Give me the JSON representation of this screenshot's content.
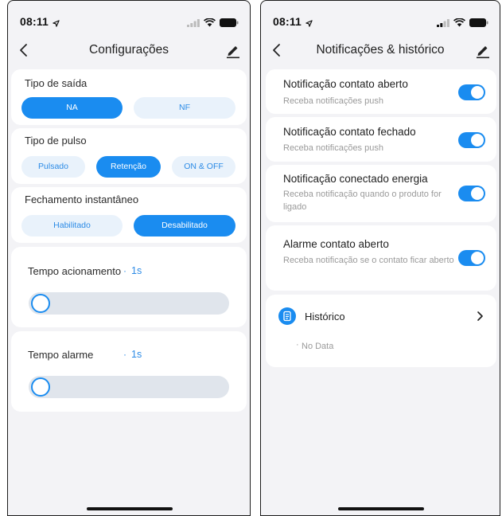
{
  "left": {
    "status": {
      "time": "08:11"
    },
    "nav": {
      "title": "Configurações"
    },
    "output_type": {
      "label": "Tipo de saída",
      "options": [
        "NA",
        "NF"
      ],
      "selected": "NA"
    },
    "pulse_type": {
      "label": "Tipo de pulso",
      "options": [
        "Pulsado",
        "Retenção",
        "ON & OFF"
      ],
      "selected": "Retenção"
    },
    "instant_close": {
      "label": "Fechamento instantâneo",
      "options": [
        "Habilitado",
        "Desabilitado"
      ],
      "selected": "Desabilitado"
    },
    "activation_time": {
      "label": "Tempo acionamento",
      "value": "1s",
      "slider_fraction": 0
    },
    "alarm_time": {
      "label": "Tempo alarme",
      "value": "1s",
      "slider_fraction": 0
    }
  },
  "right": {
    "status": {
      "time": "08:11"
    },
    "nav": {
      "title": "Notificações & histórico"
    },
    "notifications": [
      {
        "title": "Notificação contato aberto",
        "subtitle": "Receba notificações push",
        "enabled": true
      },
      {
        "title": "Notificação contato fechado",
        "subtitle": "Receba notificações push",
        "enabled": true
      },
      {
        "title": "Notificação conectado energia",
        "subtitle": "Receba notificação quando o produto for ligado",
        "enabled": true
      },
      {
        "title": "Alarme contato aberto",
        "subtitle": "Receba notificação se o contato ficar aberto",
        "enabled": true
      }
    ],
    "history": {
      "label": "Histórico",
      "empty_text": "No Data"
    }
  },
  "colors": {
    "accent": "#1a8cf0",
    "chip_off_bg": "#e9f2fb",
    "page_bg": "#f3f3f6",
    "card_bg": "#ffffff"
  },
  "icons": [
    "location-arrow-icon",
    "signal-icon",
    "wifi-icon",
    "battery-icon",
    "back-chevron-icon",
    "edit-pencil-icon",
    "history-document-icon",
    "chevron-right-icon"
  ]
}
